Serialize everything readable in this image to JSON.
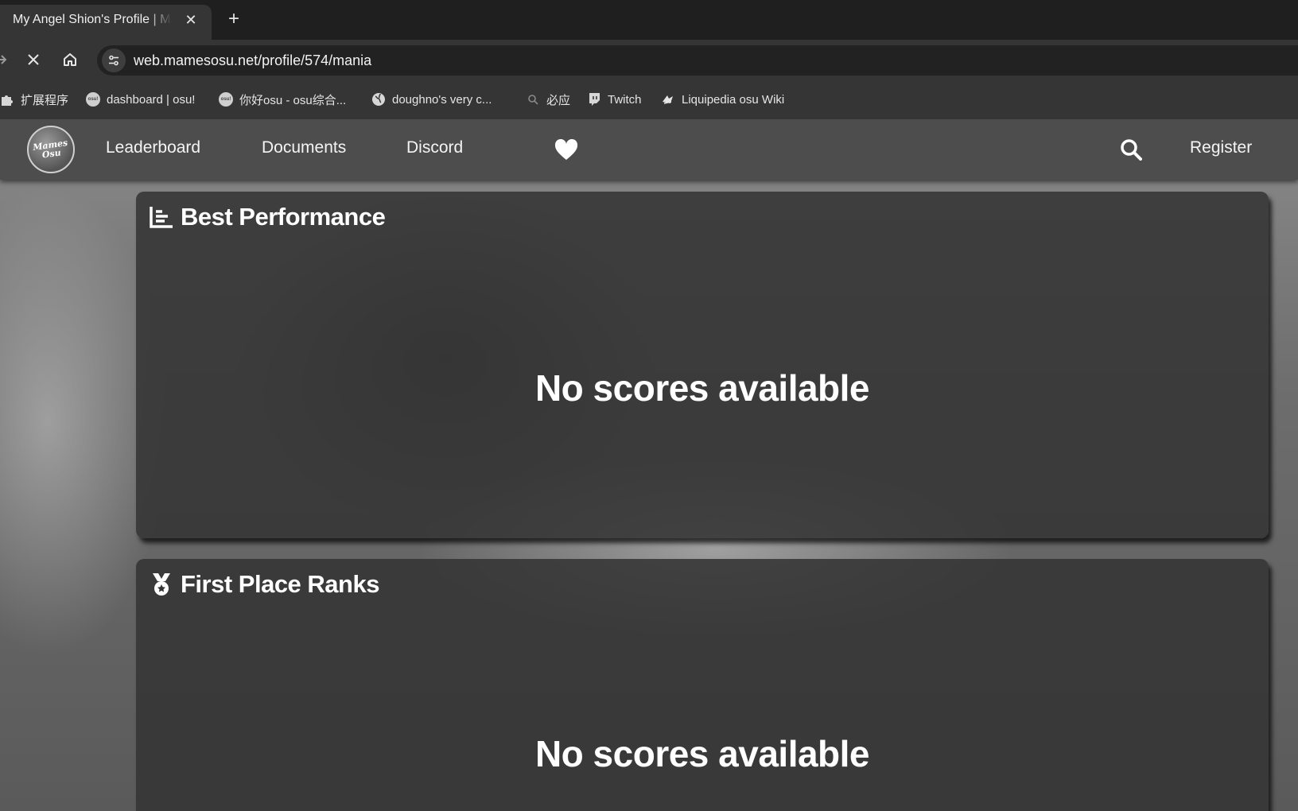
{
  "browser": {
    "tab": {
      "title": "My Angel Shion's Profile | Mamesosu",
      "close_glyph": "✕"
    },
    "new_tab_glyph": "+",
    "url": "web.mamesosu.net/profile/574/mania",
    "bookmarks": [
      {
        "label": "扩展程序",
        "icon": "puzzle-icon"
      },
      {
        "label": "dashboard | osu!",
        "icon": "osu-icon"
      },
      {
        "label": "你好osu - osu综合...",
        "icon": "osu-icon"
      },
      {
        "label": "doughno's very c...",
        "icon": "globe-icon"
      },
      {
        "label": "必应",
        "icon": "bing-search-icon"
      },
      {
        "label": "Twitch",
        "icon": "twitch-icon"
      },
      {
        "label": "Liquipedia osu Wiki",
        "icon": "liquipedia-icon"
      }
    ]
  },
  "site": {
    "logo_text": "Mames Osu",
    "nav": {
      "leaderboard": "Leaderboard",
      "documents": "Documents",
      "discord": "Discord",
      "register": "Register"
    },
    "sections": {
      "best_performance": {
        "title": "Best Performance",
        "empty": "No scores available",
        "icon": "bar-chart-icon"
      },
      "first_place": {
        "title": "First Place Ranks",
        "empty": "No scores available",
        "icon": "medal-icon"
      }
    }
  },
  "colors": {
    "tabstrip": "#1f1f1f",
    "toolbar": "#353535",
    "site_nav": "#4d4d4d",
    "card": "#343434",
    "text": "#ffffff"
  }
}
